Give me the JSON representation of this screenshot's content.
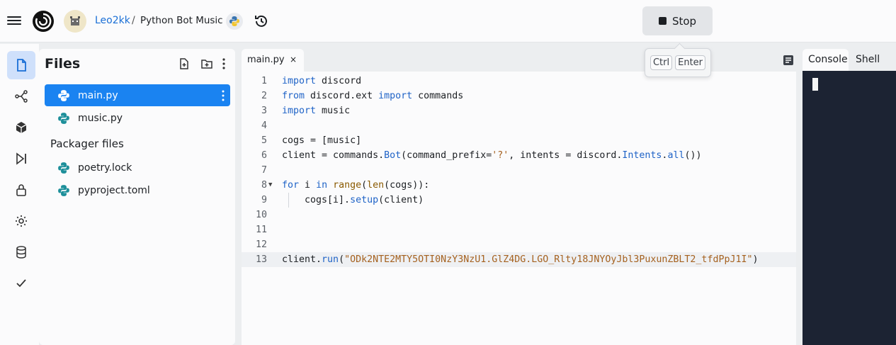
{
  "topbar": {
    "user": "Leo2kk",
    "separator": "/",
    "repl_name": "Python Bot Music",
    "stop_label": "Stop",
    "shortcut_keys": [
      "Ctrl",
      "Enter"
    ]
  },
  "sidebar_icons": [
    "files-icon",
    "git-icon",
    "packages-icon",
    "debugger-icon",
    "secrets-icon",
    "settings-icon",
    "database-icon",
    "check-icon"
  ],
  "files": {
    "title": "Files",
    "items": [
      {
        "name": "main.py",
        "active": true
      },
      {
        "name": "music.py",
        "active": false
      }
    ],
    "packager_title": "Packager files",
    "packager_items": [
      {
        "name": "poetry.lock"
      },
      {
        "name": "pyproject.toml"
      }
    ]
  },
  "editor": {
    "tab_label": "main.py",
    "tab_close": "×",
    "lines": [
      {
        "n": "1",
        "tokens": [
          [
            "kw",
            "import"
          ],
          [
            "",
            "discord"
          ]
        ]
      },
      {
        "n": "2",
        "tokens": [
          [
            "kw",
            "from"
          ],
          [
            "",
            "discord.ext "
          ],
          [
            "kw",
            "import"
          ],
          [
            "",
            " commands"
          ]
        ]
      },
      {
        "n": "3",
        "tokens": [
          [
            "kw",
            "import"
          ],
          [
            "",
            "music"
          ]
        ]
      },
      {
        "n": "4",
        "tokens": []
      },
      {
        "n": "5",
        "tokens": [
          [
            "",
            "cogs = [music]"
          ]
        ]
      },
      {
        "n": "6",
        "tokens": [
          [
            "",
            "client = commands."
          ],
          [
            "fn2",
            "Bot"
          ],
          [
            "",
            "(command_prefix="
          ],
          [
            "str",
            "'?'"
          ],
          [
            "",
            ", intents = discord."
          ],
          [
            "fn2",
            "Intents"
          ],
          [
            "",
            "."
          ],
          [
            "fn2",
            "all"
          ],
          [
            "",
            "())"
          ]
        ]
      },
      {
        "n": "7",
        "tokens": []
      },
      {
        "n": "8",
        "fold": "▼",
        "tokens": [
          [
            "kw",
            "for"
          ],
          [
            "",
            " i "
          ],
          [
            "kw",
            "in"
          ],
          [
            "",
            " "
          ],
          [
            "fn",
            "range"
          ],
          [
            "",
            "("
          ],
          [
            "fn",
            "len"
          ],
          [
            "",
            "(cogs)):"
          ]
        ]
      },
      {
        "n": "9",
        "indent": true,
        "tokens": [
          [
            "",
            "    cogs[i]."
          ],
          [
            "fn2",
            "setup"
          ],
          [
            "",
            "(client)"
          ]
        ]
      },
      {
        "n": "10",
        "tokens": []
      },
      {
        "n": "11",
        "tokens": []
      },
      {
        "n": "12",
        "tokens": []
      },
      {
        "n": "13",
        "hl": true,
        "tokens": [
          [
            "",
            "client."
          ],
          [
            "fn2",
            "run"
          ],
          [
            "",
            "("
          ],
          [
            "str",
            "\"ODk2NTE2MTY5OTI0NzY3NzU1.GlZ4DG.LGO_Rlty18JNYOyJbl3PuxunZBLT2_tfdPpJ1I\""
          ],
          [
            "",
            ")"
          ]
        ]
      }
    ]
  },
  "console": {
    "tabs": [
      "Console",
      "Shell"
    ]
  },
  "colors": {
    "accent": "#1a83f1",
    "console_bg": "#1c2333",
    "keyword": "#1f63c7",
    "string": "#a5611f"
  }
}
